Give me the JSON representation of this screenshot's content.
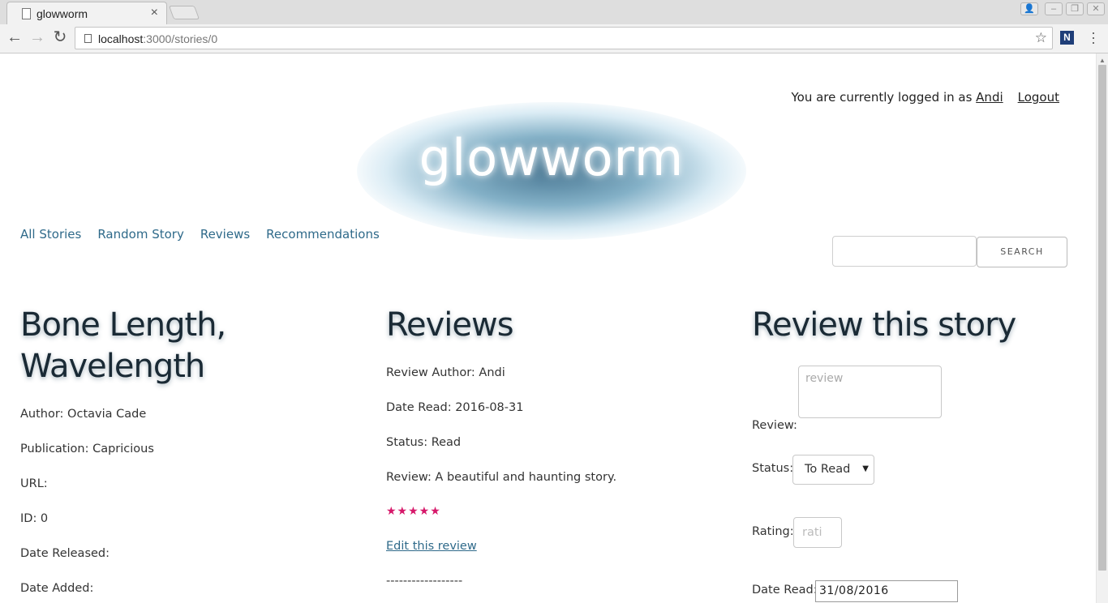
{
  "browser": {
    "tab_title": "glowworm",
    "tab_close": "×",
    "url_host": "localhost",
    "url_path": ":3000/stories/0",
    "back": "←",
    "forward": "→",
    "reload": "↻",
    "star": "☆",
    "extension_label": "N",
    "menu": "⋮",
    "window_buttons": [
      "👤",
      "–",
      "❐",
      "✕"
    ]
  },
  "header": {
    "login_prefix": "You are currently logged in as ",
    "username": "Andi",
    "logout": "Logout",
    "logo": "glowworm"
  },
  "nav": {
    "items": [
      "All Stories",
      "Random Story",
      "Reviews",
      "Recommendations"
    ]
  },
  "search": {
    "button": "SEARCH",
    "value": ""
  },
  "story": {
    "title": "Bone Length, Wavelength",
    "author": "Author: Octavia Cade",
    "publication": "Publication: Capricious",
    "url": "URL:",
    "id": "ID: 0",
    "date_released": "Date Released:",
    "date_added": "Date Added:"
  },
  "reviews": {
    "heading": "Reviews",
    "items": [
      {
        "author": "Review Author: Andi",
        "date_read": "Date Read: 2016-08-31",
        "status": "Status: Read",
        "review": "Review: A beautiful and haunting story.",
        "stars": "★★★★★",
        "rating": 5,
        "edit_link": "Edit this review",
        "divider": "------------------"
      }
    ]
  },
  "review_form": {
    "heading": "Review this story",
    "review_label": "Review:",
    "review_placeholder": "review",
    "status_label": "Status:",
    "status_value": "To Read",
    "rating_label": "Rating:",
    "rating_placeholder": "rati",
    "date_label": "Date Read:",
    "date_value": "31/08/2016"
  },
  "colors": {
    "link": "#2f6a8a",
    "stars": "#d6186a",
    "logo_glow": "#3c6e8c"
  }
}
